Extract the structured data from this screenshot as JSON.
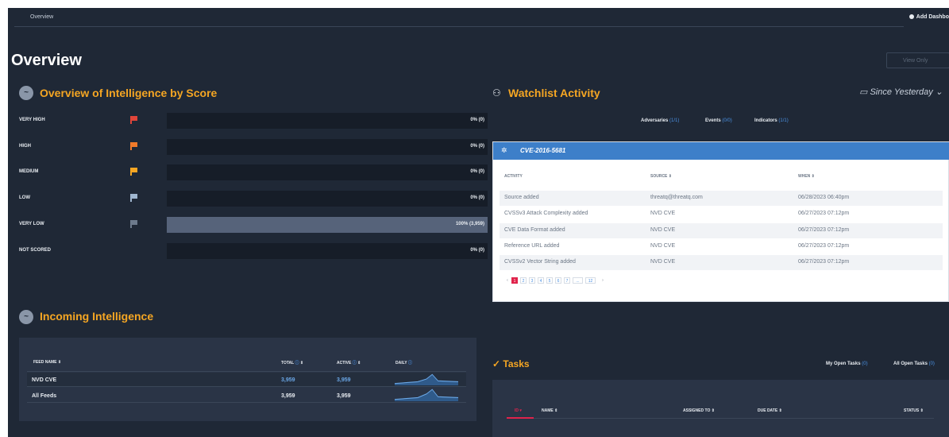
{
  "topbar": {
    "breadcrumb": "Overview",
    "add_dashboard": "Add Dashbo"
  },
  "page": {
    "title": "Overview",
    "view_only": "View Only"
  },
  "score_section": {
    "title": "Overview of Intelligence by Score",
    "rows": [
      {
        "label": "VERY HIGH",
        "value_text": "0% (0)",
        "fraction": 0,
        "flag_color": "#e0453a"
      },
      {
        "label": "HIGH",
        "value_text": "0% (0)",
        "fraction": 0,
        "flag_color": "#f07a2a"
      },
      {
        "label": "MEDIUM",
        "value_text": "0% (0)",
        "fraction": 0,
        "flag_color": "#f5a623"
      },
      {
        "label": "LOW",
        "value_text": "0% (0)",
        "fraction": 0,
        "flag_color": "#9fb6cf"
      },
      {
        "label": "VERY LOW",
        "value_text": "100% (3,959)",
        "fraction": 1,
        "flag_color": "#6d7a8c"
      },
      {
        "label": "NOT SCORED",
        "value_text": "0% (0)",
        "fraction": 0,
        "flag_color": ""
      }
    ]
  },
  "incoming": {
    "title": "Incoming Intelligence",
    "headers": {
      "feed": "FEED NAME",
      "total": "TOTAL",
      "active": "ACTIVE",
      "daily": "DAILY"
    },
    "rows": [
      {
        "name": "NVD CVE",
        "total": "3,959",
        "active": "3,959"
      },
      {
        "name": "All Feeds",
        "total": "3,959",
        "active": "3,959"
      }
    ]
  },
  "watchlist": {
    "title": "Watchlist Activity",
    "since": "Since Yesterday",
    "filters": [
      {
        "label": "Adversaries",
        "count": "(1/1)"
      },
      {
        "label": "Events",
        "count": "(0/0)"
      },
      {
        "label": "Indicators",
        "count": "(1/1)"
      }
    ],
    "card": {
      "title": "CVE-2016-5681",
      "headers": {
        "activity": "ACTIVITY",
        "source": "SOURCE",
        "when": "WHEN"
      },
      "rows": [
        {
          "activity": "Source added",
          "source": "threatq@threatq.com",
          "when": "06/28/2023 06:40pm"
        },
        {
          "activity": "CVSSv3 Attack Complexity added",
          "source": "NVD CVE",
          "when": "06/27/2023 07:12pm"
        },
        {
          "activity": "CVE Data Format added",
          "source": "NVD CVE",
          "when": "06/27/2023 07:12pm"
        },
        {
          "activity": "Reference URL added",
          "source": "NVD CVE",
          "when": "06/27/2023 07:12pm"
        },
        {
          "activity": "CVSSv2 Vector String added",
          "source": "NVD CVE",
          "when": "06/27/2023 07:12pm"
        }
      ],
      "pages": [
        "1",
        "2",
        "3",
        "4",
        "5",
        "6",
        "7",
        "...",
        "12"
      ]
    }
  },
  "tasks": {
    "title": "Tasks",
    "tabs": [
      {
        "label": "My Open Tasks",
        "count": "(0)"
      },
      {
        "label": "All Open Tasks",
        "count": "(0)"
      }
    ],
    "headers": {
      "id": "ID",
      "name": "NAME",
      "assigned": "ASSIGNED TO",
      "due": "DUE DATE",
      "status": "STATUS"
    }
  }
}
